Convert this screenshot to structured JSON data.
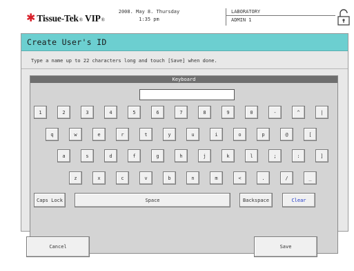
{
  "header": {
    "brand": "Tissue-Tek",
    "brand_suffix": "VIP",
    "date_line": "2008. May 8. Thursday",
    "time_line": "1:35 pm",
    "location": "LABORATORY",
    "user": "ADMIN 1",
    "lock_icon": "padlock-icon"
  },
  "page": {
    "title": "Create User's ID",
    "instruction": "Type a name up to 22 characters long and touch [Save] when done."
  },
  "keyboard": {
    "header": "Keyboard",
    "input_value": "",
    "rows": [
      [
        "1",
        "2",
        "3",
        "4",
        "5",
        "6",
        "7",
        "8",
        "9",
        "0",
        "-",
        "^",
        "|"
      ],
      [
        "q",
        "w",
        "e",
        "r",
        "t",
        "y",
        "u",
        "i",
        "o",
        "p",
        "@",
        "["
      ],
      [
        "a",
        "s",
        "d",
        "f",
        "g",
        "h",
        "j",
        "k",
        "l",
        ";",
        ":",
        "]"
      ],
      [
        "z",
        "x",
        "c",
        "v",
        "b",
        "n",
        "m",
        "<",
        ".",
        "/",
        "_"
      ]
    ],
    "caps_lock": "Caps Lock",
    "space": "Space",
    "backspace": "Backspace",
    "clear": "Clear"
  },
  "footer": {
    "cancel": "Cancel",
    "save": "Save"
  },
  "colors": {
    "title_bar": "#6ccfd0",
    "brand_star": "#d8202a",
    "clear_text": "#1d37c8"
  }
}
